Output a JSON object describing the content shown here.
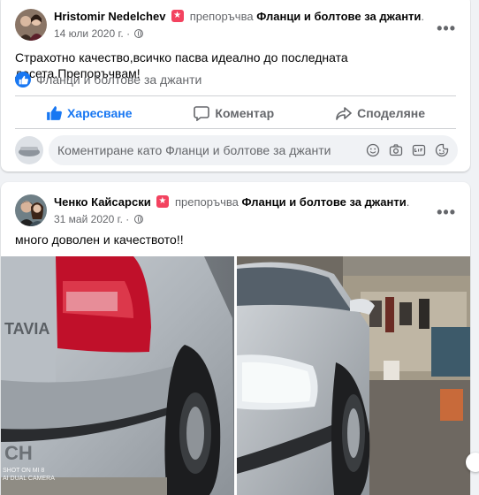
{
  "posts": [
    {
      "author": "Hristomir Nedelchev",
      "verb": "препоръчва",
      "page": "Фланци и болтове за джанти",
      "date": "14 юли 2020 г.",
      "dot": "·",
      "text": "Страхотно качество,всичко пасва идеално до последната десета.Препоръчвам!",
      "tag": "Фланци и болтове за джанти",
      "more": "•••"
    },
    {
      "author": "Ченко Кайсарски",
      "verb": "препоръчва",
      "page": "Фланци и болтове за джанти",
      "date": "31 май 2020 г.",
      "dot": "·",
      "text": "много доволен и качеството!!",
      "more": "•••",
      "photo_watermark": [
        "SHOT ON MI 8",
        "AI DUAL CAMERA"
      ]
    }
  ],
  "actions": {
    "like": "Харесване",
    "comment": "Коментар",
    "share": "Споделяне"
  },
  "comment_box": {
    "placeholder": "Коментиране като Фланци и болтове за джанти"
  },
  "colors": {
    "accent": "#1877f2",
    "recommend_badge": "#f3425f",
    "secondary_text": "#65676b"
  },
  "icons": [
    "thumbs-up-icon",
    "comment-icon",
    "share-icon",
    "emoji-icon",
    "camera-icon",
    "gif-icon",
    "sticker-icon",
    "globe-icon",
    "recommend-badge-icon"
  ]
}
